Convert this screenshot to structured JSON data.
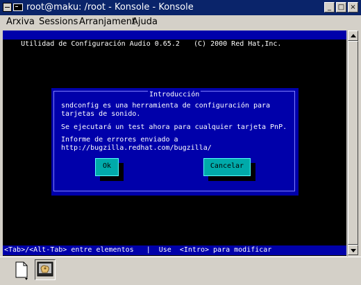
{
  "window": {
    "title": "root@maku: /root - Konsole - Konsole",
    "minimize_glyph": "_",
    "maximize_glyph": "□",
    "close_glyph": "×"
  },
  "menu": {
    "items": [
      "Arxiva",
      "Sessions",
      "Arranjament",
      "Ajuda"
    ]
  },
  "terminal": {
    "header_left": "Utilidad de Configuración Audio 0.65.2",
    "header_right": "(C) 2000 Red Hat,Inc.",
    "footer": "<Tab>/<Alt-Tab> entre elementos   |  Use  <Intro> para modificar",
    "dialog": {
      "title": "Introducción",
      "lines": [
        "sndconfig es una herramienta de configuración para",
        "tarjetas de sonido.",
        "",
        "Se ejecutará un test ahora para cualquier tarjeta PnP.",
        "",
        "Informe de errores enviado a",
        "http://bugzilla.redhat.com/bugzilla/"
      ],
      "ok_label": "Ok",
      "cancel_label": "Cancelar"
    }
  },
  "colors": {
    "titlebar": "#0a246a",
    "terminal_bg": "#000000",
    "dialog_bg": "#0000aa",
    "button_bg": "#00aaaa"
  },
  "toolbar": {
    "icons": [
      "new-session-icon",
      "konsole-session-icon"
    ]
  }
}
